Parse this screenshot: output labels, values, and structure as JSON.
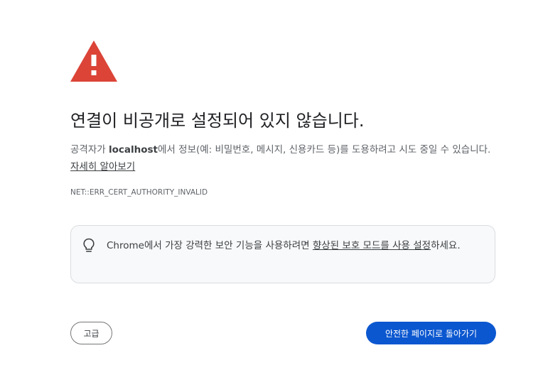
{
  "heading": "연결이 비공개로 설정되어 있지 않습니다.",
  "explanation": {
    "prefix": "공격자가 ",
    "host": "localhost",
    "suffix": "에서 정보(예: 비밀번호, 메시지, 신용카드 등)를 도용하려고 시도 중일 수 있습니다. ",
    "learn_more_link": "자세히 알아보기"
  },
  "error_code": "NET::ERR_CERT_AUTHORITY_INVALID",
  "tip": {
    "prefix": "Chrome에서 가장 강력한 보안 기능을 사용하려면 ",
    "link": "향상된 보호 모드를 사용 설정",
    "suffix": "하세요."
  },
  "buttons": {
    "advanced": "고급",
    "back_to_safety": "안전한 페이지로 돌아가기"
  },
  "icons": {
    "warning": "warning-triangle-icon",
    "tip": "lightbulb-icon"
  },
  "colors": {
    "warning_red": "#db4437",
    "primary_button": "#0b57d0"
  }
}
